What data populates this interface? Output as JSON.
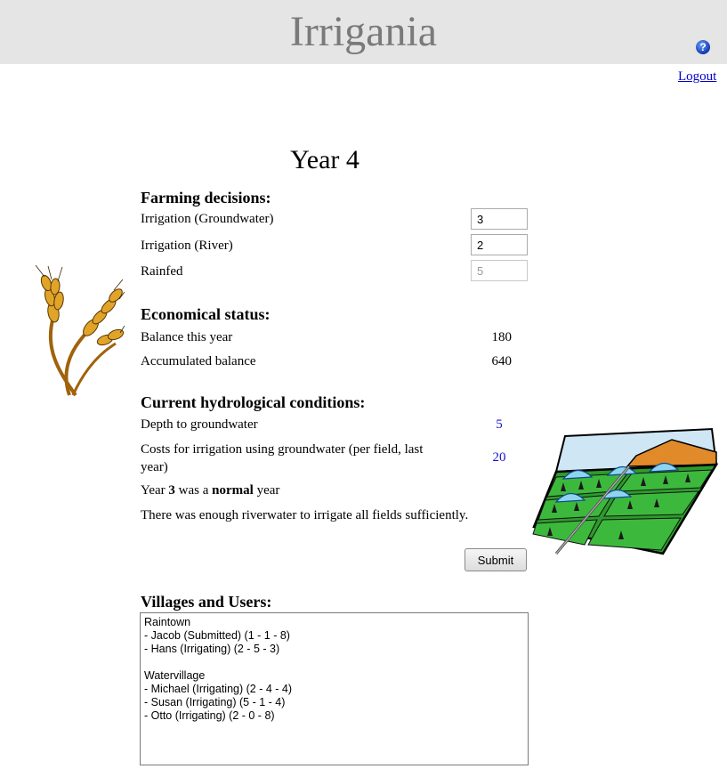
{
  "header": {
    "title": "Irrigania"
  },
  "nav": {
    "logout": "Logout"
  },
  "year_title": "Year 4",
  "farming": {
    "heading": "Farming decisions:",
    "rows": [
      {
        "label": "Irrigation (Groundwater)",
        "value": "3"
      },
      {
        "label": "Irrigation (River)",
        "value": "2"
      },
      {
        "label": "Rainfed",
        "value": "5"
      }
    ]
  },
  "economy": {
    "heading": "Economical status:",
    "rows": [
      {
        "label": "Balance this year",
        "value": "180"
      },
      {
        "label": "Accumulated balance",
        "value": "640"
      }
    ]
  },
  "hydro": {
    "heading": "Current hydrological conditions:",
    "depth_label": "Depth to groundwater",
    "depth_value": "5",
    "cost_label_line1": "Costs for irrigation using groundwater (per field, last",
    "cost_label_line2": "year)",
    "cost_value": "20",
    "year_prefix": "Year ",
    "year_num": "3",
    "year_mid": " was a ",
    "year_kind": "normal",
    "year_suffix": " year",
    "river_note": "There was enough riverwater to irrigate all fields sufficiently."
  },
  "submit_label": "Submit",
  "villages": {
    "heading": "Villages and Users:",
    "lines": [
      "Raintown",
      "- Jacob (Submitted) (1 - 1 - 8)",
      "- Hans (Irrigating) (2 - 5 - 3)",
      "",
      "Watervillage",
      "- Michael (Irrigating) (2 - 4 - 4)",
      "- Susan (Irrigating) (5 - 1 - 4)",
      "- Otto (Irrigating) (2 - 0 - 8)"
    ]
  },
  "icons": {
    "help": "help-icon",
    "wheat": "wheat-illustration",
    "fields": "irrigated-fields-illustration"
  },
  "colors": {
    "header_bg": "#e5e5e5",
    "title": "#7a7a7a",
    "link": "#0000cc",
    "value_blue": "#1414d2"
  }
}
